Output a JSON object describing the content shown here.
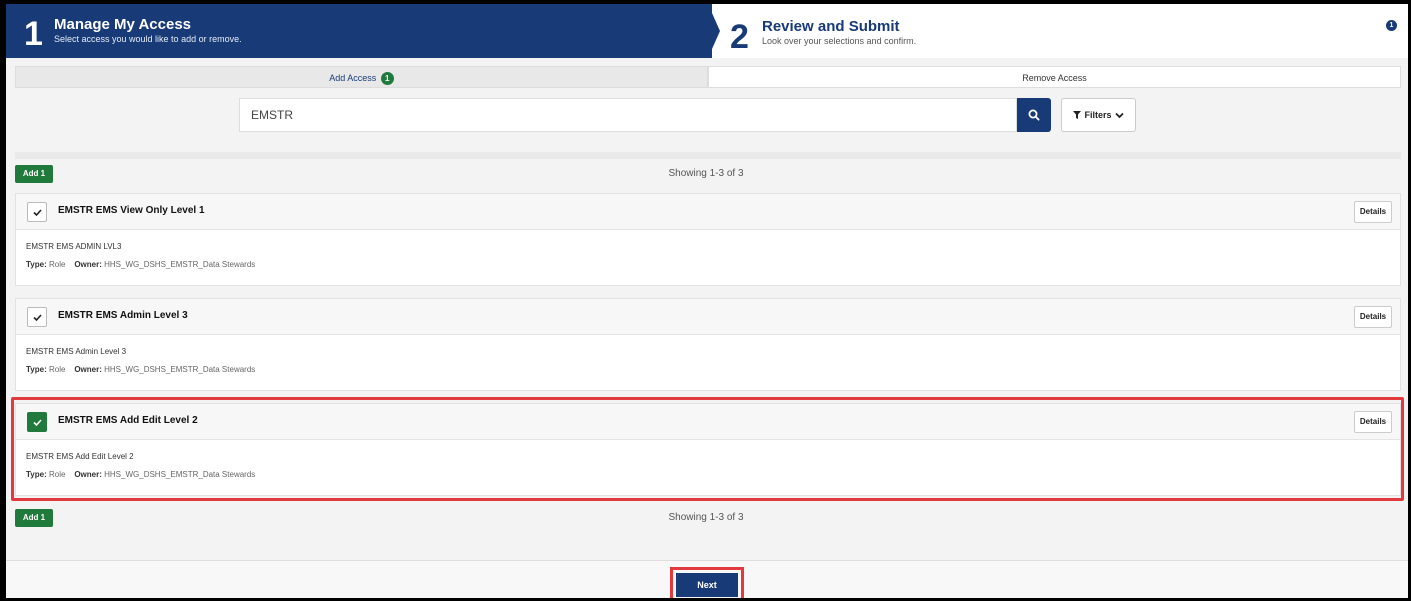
{
  "steps": {
    "step1": {
      "number": "1",
      "title": "Manage My Access",
      "subtitle": "Select access you would like to add or remove."
    },
    "step2": {
      "number": "2",
      "title": "Review and Submit",
      "subtitle": "Look over your selections and confirm."
    },
    "notification_count": "1"
  },
  "tabs": {
    "add": {
      "label": "Add Access",
      "badge": "1"
    },
    "remove": {
      "label": "Remove Access"
    }
  },
  "search": {
    "value": "EMSTR",
    "filters_label": "Filters"
  },
  "results": {
    "add_button_label": "Add 1",
    "showing_text": "Showing 1-3 of 3",
    "items": [
      {
        "title": "EMSTR EMS View Only Level 1",
        "description": "EMSTR EMS ADMIN LVL3",
        "type_label": "Type:",
        "type": "Role",
        "owner_label": "Owner:",
        "owner": "HHS_WG_DSHS_EMSTR_Data Stewards",
        "details_label": "Details",
        "checked": false
      },
      {
        "title": "EMSTR EMS Admin Level 3",
        "description": "EMSTR EMS Admin Level 3",
        "type_label": "Type:",
        "type": "Role",
        "owner_label": "Owner:",
        "owner": "HHS_WG_DSHS_EMSTR_Data Stewards",
        "details_label": "Details",
        "checked": false
      },
      {
        "title": "EMSTR EMS Add Edit Level 2",
        "description": "EMSTR EMS Add Edit Level 2",
        "type_label": "Type:",
        "type": "Role",
        "owner_label": "Owner:",
        "owner": "HHS_WG_DSHS_EMSTR_Data Stewards",
        "details_label": "Details",
        "checked": true
      }
    ]
  },
  "footer": {
    "next_label": "Next"
  },
  "colors": {
    "brand": "#183b78",
    "success": "#1f7a3b",
    "highlight": "#e0393e"
  }
}
